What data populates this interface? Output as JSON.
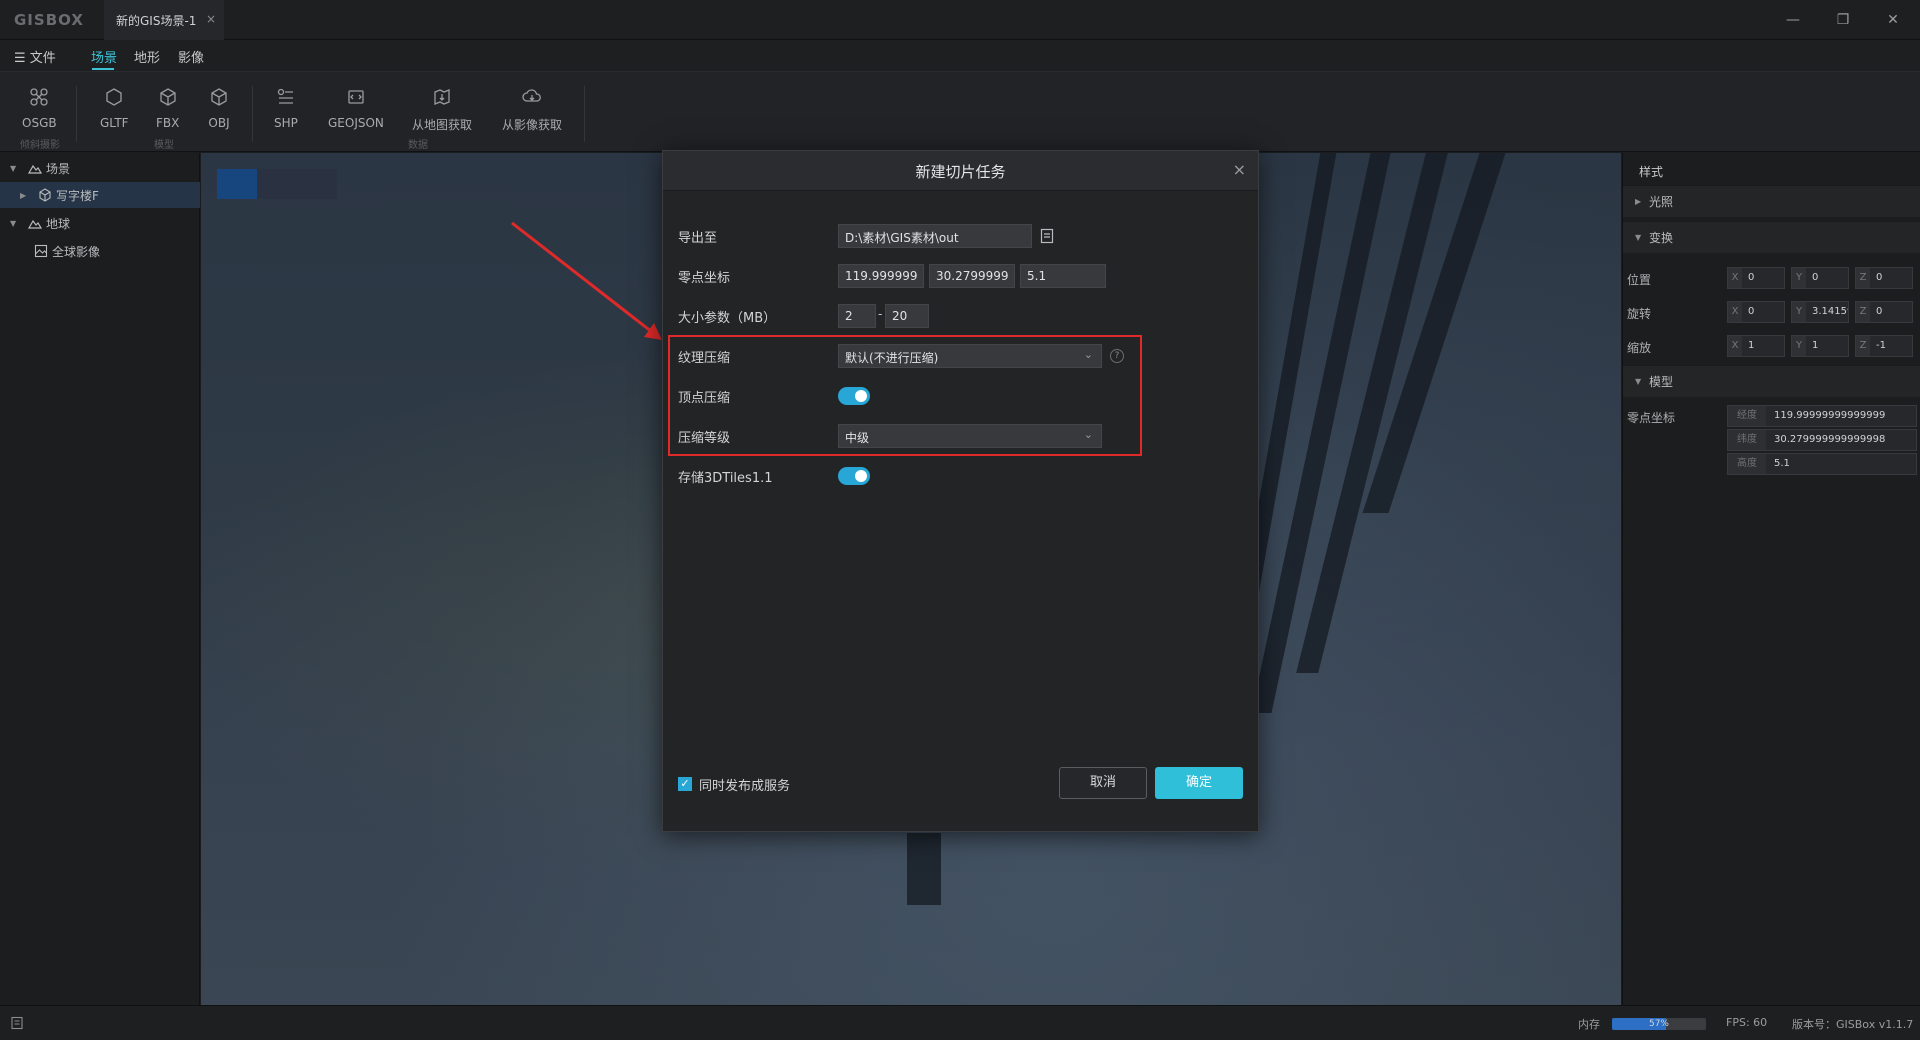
{
  "app": {
    "logo": "GISBOX",
    "tab_title": "新的GIS场景-1",
    "tab_close": "×",
    "win_min": "—",
    "win_restore": "❐",
    "win_close": "✕"
  },
  "menu": {
    "file": "文件",
    "tabs": [
      "场景",
      "地形",
      "影像"
    ],
    "active_tab": "场景"
  },
  "ribbon": {
    "buttons": [
      "OSGB",
      "GLTF",
      "FBX",
      "OBJ",
      "SHP",
      "GEOJSON",
      "从地图获取",
      "从影像获取"
    ],
    "groups": [
      "倾斜摄影",
      "模型",
      "数据"
    ]
  },
  "tree": {
    "items": [
      {
        "label": "场景",
        "icon": "mountain-icon"
      },
      {
        "label": "写字楼F",
        "icon": "cube-icon"
      },
      {
        "label": "地球",
        "icon": "mountain-icon"
      },
      {
        "label": "全球影像",
        "icon": "image-icon"
      }
    ]
  },
  "dialog": {
    "title": "新建切片任务",
    "close": "×",
    "export_label": "导出至",
    "export_path": "D:\\素材\\GIS素材\\out",
    "origin_label": "零点坐标",
    "origin_lon": "119.999999",
    "origin_lat": "30.2799999",
    "origin_h": "5.1",
    "size_label": "大小参数（MB）",
    "size_min": "2",
    "size_dash": "-",
    "size_max": "20",
    "texture_label": "纹理压缩",
    "texture_value": "默认(不进行压缩)",
    "help": "?",
    "vertex_label": "顶点压缩",
    "level_label": "压缩等级",
    "level_value": "中级",
    "store_label": "存储3DTiles1.1",
    "publish_label": "同时发布成服务",
    "cancel": "取消",
    "ok": "确定",
    "highlight_color": "#e02a2a",
    "accent_color": "#2fbfd8"
  },
  "rightpanel": {
    "tab": "样式",
    "sections": {
      "light": "光照",
      "transform": "变换",
      "model": "模型"
    },
    "position_label": "位置",
    "rotation_label": "旋转",
    "scale_label": "缩放",
    "position": {
      "x": "0",
      "y": "0",
      "z": "0"
    },
    "rotation": {
      "x": "0",
      "y": "3.14159",
      "z": "0"
    },
    "scale": {
      "x": "1",
      "y": "1",
      "z": "-1"
    },
    "axis_x": "X",
    "axis_y": "Y",
    "axis_z": "Z",
    "origin_label": "零点坐标",
    "lon_label": "经度",
    "lat_label": "纬度",
    "h_label": "高度",
    "lon": "119.99999999999999",
    "lat": "30.279999999999998",
    "h": "5.1"
  },
  "status": {
    "memory_label": "内存",
    "memory_pct": "57%",
    "memory_fraction": 0.57,
    "fps": "FPS: 60",
    "version": "版本号：GISBox v1.1.7"
  }
}
